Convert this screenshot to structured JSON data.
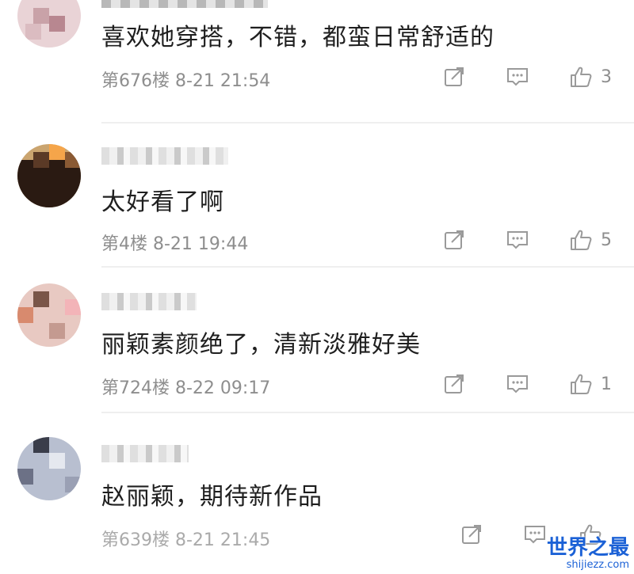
{
  "comments": [
    {
      "text": "喜欢她穿搭，不错，都蛮日常舒适的",
      "meta": "第676楼 8-21 21:54",
      "likes": "3"
    },
    {
      "text": "太好看了啊",
      "meta": "第4楼 8-21 19:44",
      "likes": "5"
    },
    {
      "text": "丽颖素颜绝了，清新淡雅好美",
      "meta": "第724楼 8-22 09:17",
      "likes": "1"
    },
    {
      "text": "赵丽颖，期待新作品",
      "meta": "第639楼 8-21 21:45",
      "likes": ""
    }
  ],
  "icons": {
    "share": "share-icon",
    "comment": "comment-icon",
    "like": "thumbs-up-icon"
  },
  "watermark": {
    "title": "世界之最",
    "url": "shijiezz.com"
  },
  "colors": {
    "text": "#1f1f1f",
    "meta": "#8e8e8e",
    "icon": "#9a9a9a",
    "watermark": "#1b61d6"
  }
}
